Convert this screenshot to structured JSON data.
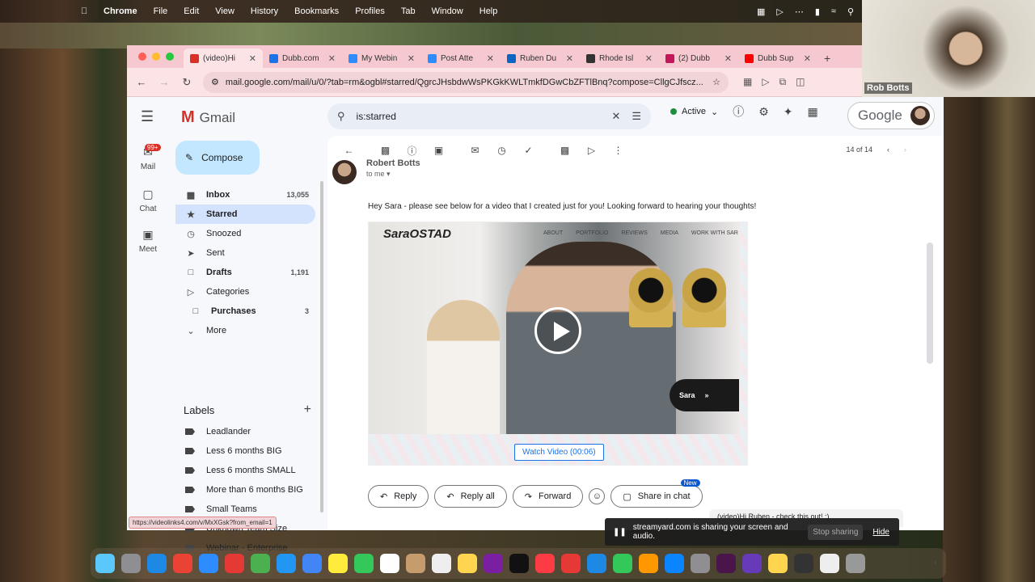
{
  "menubar": {
    "app": "Chrome",
    "items": [
      "File",
      "Edit",
      "View",
      "History",
      "Bookmarks",
      "Profiles",
      "Tab",
      "Window",
      "Help"
    ]
  },
  "presenter": {
    "name": "Rob Botts"
  },
  "tabs": [
    {
      "title": "(video)Hi",
      "color": "#d93025",
      "active": true
    },
    {
      "title": "Dubb.com",
      "color": "#1a73e8"
    },
    {
      "title": "My Webin",
      "color": "#2d8cff"
    },
    {
      "title": "Post Atte",
      "color": "#2d8cff"
    },
    {
      "title": "Ruben Du",
      "color": "#0a66c2"
    },
    {
      "title": "Rhode Isl",
      "color": "#333333"
    },
    {
      "title": "(2) Dubb",
      "color": "#c2185b"
    },
    {
      "title": "Dubb Sup",
      "color": "#ff0000"
    }
  ],
  "address": {
    "url": "mail.google.com/mail/u/0/?tab=rm&ogbl#starred/QgrcJHsbdwWsPKGkKWLTmkfDGwCbZFTlBnq?compose=CllgCJfscz..."
  },
  "gmail": {
    "product": "Gmail",
    "rail": {
      "mail": "Mail",
      "badge": "99+",
      "chat": "Chat",
      "meet": "Meet"
    },
    "compose": "Compose",
    "nav": [
      {
        "label": "Inbox",
        "count": "13,055",
        "bold": true
      },
      {
        "label": "Starred",
        "count": "",
        "active": true
      },
      {
        "label": "Snoozed",
        "count": ""
      },
      {
        "label": "Sent",
        "count": ""
      },
      {
        "label": "Drafts",
        "count": "1,191",
        "bold": true
      },
      {
        "label": "Categories",
        "count": ""
      },
      {
        "label": "Purchases",
        "count": "3",
        "bold": true
      },
      {
        "label": "More",
        "count": ""
      }
    ],
    "labels_title": "Labels",
    "labels": [
      "Leadlander",
      "Less 6 months BIG",
      "Less 6 months SMALL",
      "More than 6 months BIG",
      "Small Teams",
      "Unknown Team Size",
      "Webinar - Enterprise"
    ],
    "search": {
      "query": "is:starred"
    },
    "status": "Active",
    "account": "Google",
    "pager": "14 of 14",
    "message": {
      "sender": "Robert Botts",
      "to": "to me",
      "body": "Hey Sara - please see below for a video that I created just for you! Looking forward to hearing your thoughts!",
      "video": {
        "brand": "SaraOSTAD",
        "menu": [
          "ABOUT",
          "PORTFOLIO",
          "REVIEWS",
          "MEDIA",
          "WORK WITH SAR"
        ],
        "cta": "Sara",
        "watch": "Watch Video (00:06)"
      }
    },
    "actions": {
      "reply": "Reply",
      "reply_all": "Reply all",
      "forward": "Forward",
      "share": "Share in chat",
      "new": "New"
    },
    "draft": "(video)Hi Ruben - check this out! :)",
    "status_url": "https://videolinks4.com/v/MxXGsk?from_email=1"
  },
  "share_banner": {
    "message": "streamyard.com is sharing your screen and audio.",
    "stop": "Stop sharing",
    "hide": "Hide"
  },
  "dock_colors": [
    "#5ac8fa",
    "#8e8e93",
    "#1e88e5",
    "#ea4335",
    "#2d8cff",
    "#e53935",
    "#4caf50",
    "#2196f3",
    "#4285f4",
    "#ffeb3b",
    "#34c759",
    "#ffffff",
    "#c69c6d",
    "#eeeeee",
    "#ffd54f",
    "#7b1fa2",
    "#111111",
    "#fc3c44",
    "#e53935",
    "#1e88e5",
    "#34c759",
    "#ff9800",
    "#0a84ff",
    "#8e8e93",
    "#4a154b",
    "#673ab7",
    "#ffd54f",
    "#333333",
    "#eeeeee",
    "#999999"
  ]
}
